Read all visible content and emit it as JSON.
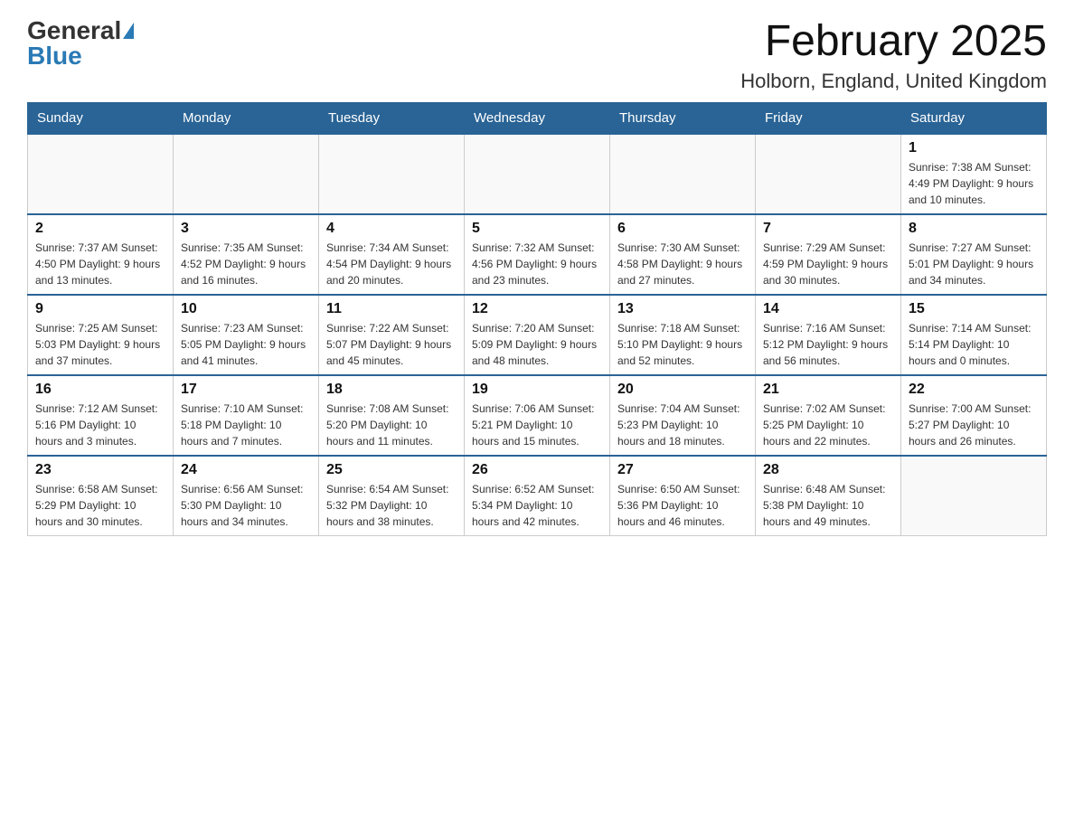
{
  "header": {
    "logo_general": "General",
    "logo_blue": "Blue",
    "title": "February 2025",
    "location": "Holborn, England, United Kingdom"
  },
  "weekdays": [
    "Sunday",
    "Monday",
    "Tuesday",
    "Wednesday",
    "Thursday",
    "Friday",
    "Saturday"
  ],
  "weeks": [
    [
      {
        "day": "",
        "info": ""
      },
      {
        "day": "",
        "info": ""
      },
      {
        "day": "",
        "info": ""
      },
      {
        "day": "",
        "info": ""
      },
      {
        "day": "",
        "info": ""
      },
      {
        "day": "",
        "info": ""
      },
      {
        "day": "1",
        "info": "Sunrise: 7:38 AM\nSunset: 4:49 PM\nDaylight: 9 hours and 10 minutes."
      }
    ],
    [
      {
        "day": "2",
        "info": "Sunrise: 7:37 AM\nSunset: 4:50 PM\nDaylight: 9 hours and 13 minutes."
      },
      {
        "day": "3",
        "info": "Sunrise: 7:35 AM\nSunset: 4:52 PM\nDaylight: 9 hours and 16 minutes."
      },
      {
        "day": "4",
        "info": "Sunrise: 7:34 AM\nSunset: 4:54 PM\nDaylight: 9 hours and 20 minutes."
      },
      {
        "day": "5",
        "info": "Sunrise: 7:32 AM\nSunset: 4:56 PM\nDaylight: 9 hours and 23 minutes."
      },
      {
        "day": "6",
        "info": "Sunrise: 7:30 AM\nSunset: 4:58 PM\nDaylight: 9 hours and 27 minutes."
      },
      {
        "day": "7",
        "info": "Sunrise: 7:29 AM\nSunset: 4:59 PM\nDaylight: 9 hours and 30 minutes."
      },
      {
        "day": "8",
        "info": "Sunrise: 7:27 AM\nSunset: 5:01 PM\nDaylight: 9 hours and 34 minutes."
      }
    ],
    [
      {
        "day": "9",
        "info": "Sunrise: 7:25 AM\nSunset: 5:03 PM\nDaylight: 9 hours and 37 minutes."
      },
      {
        "day": "10",
        "info": "Sunrise: 7:23 AM\nSunset: 5:05 PM\nDaylight: 9 hours and 41 minutes."
      },
      {
        "day": "11",
        "info": "Sunrise: 7:22 AM\nSunset: 5:07 PM\nDaylight: 9 hours and 45 minutes."
      },
      {
        "day": "12",
        "info": "Sunrise: 7:20 AM\nSunset: 5:09 PM\nDaylight: 9 hours and 48 minutes."
      },
      {
        "day": "13",
        "info": "Sunrise: 7:18 AM\nSunset: 5:10 PM\nDaylight: 9 hours and 52 minutes."
      },
      {
        "day": "14",
        "info": "Sunrise: 7:16 AM\nSunset: 5:12 PM\nDaylight: 9 hours and 56 minutes."
      },
      {
        "day": "15",
        "info": "Sunrise: 7:14 AM\nSunset: 5:14 PM\nDaylight: 10 hours and 0 minutes."
      }
    ],
    [
      {
        "day": "16",
        "info": "Sunrise: 7:12 AM\nSunset: 5:16 PM\nDaylight: 10 hours and 3 minutes."
      },
      {
        "day": "17",
        "info": "Sunrise: 7:10 AM\nSunset: 5:18 PM\nDaylight: 10 hours and 7 minutes."
      },
      {
        "day": "18",
        "info": "Sunrise: 7:08 AM\nSunset: 5:20 PM\nDaylight: 10 hours and 11 minutes."
      },
      {
        "day": "19",
        "info": "Sunrise: 7:06 AM\nSunset: 5:21 PM\nDaylight: 10 hours and 15 minutes."
      },
      {
        "day": "20",
        "info": "Sunrise: 7:04 AM\nSunset: 5:23 PM\nDaylight: 10 hours and 18 minutes."
      },
      {
        "day": "21",
        "info": "Sunrise: 7:02 AM\nSunset: 5:25 PM\nDaylight: 10 hours and 22 minutes."
      },
      {
        "day": "22",
        "info": "Sunrise: 7:00 AM\nSunset: 5:27 PM\nDaylight: 10 hours and 26 minutes."
      }
    ],
    [
      {
        "day": "23",
        "info": "Sunrise: 6:58 AM\nSunset: 5:29 PM\nDaylight: 10 hours and 30 minutes."
      },
      {
        "day": "24",
        "info": "Sunrise: 6:56 AM\nSunset: 5:30 PM\nDaylight: 10 hours and 34 minutes."
      },
      {
        "day": "25",
        "info": "Sunrise: 6:54 AM\nSunset: 5:32 PM\nDaylight: 10 hours and 38 minutes."
      },
      {
        "day": "26",
        "info": "Sunrise: 6:52 AM\nSunset: 5:34 PM\nDaylight: 10 hours and 42 minutes."
      },
      {
        "day": "27",
        "info": "Sunrise: 6:50 AM\nSunset: 5:36 PM\nDaylight: 10 hours and 46 minutes."
      },
      {
        "day": "28",
        "info": "Sunrise: 6:48 AM\nSunset: 5:38 PM\nDaylight: 10 hours and 49 minutes."
      },
      {
        "day": "",
        "info": ""
      }
    ]
  ]
}
